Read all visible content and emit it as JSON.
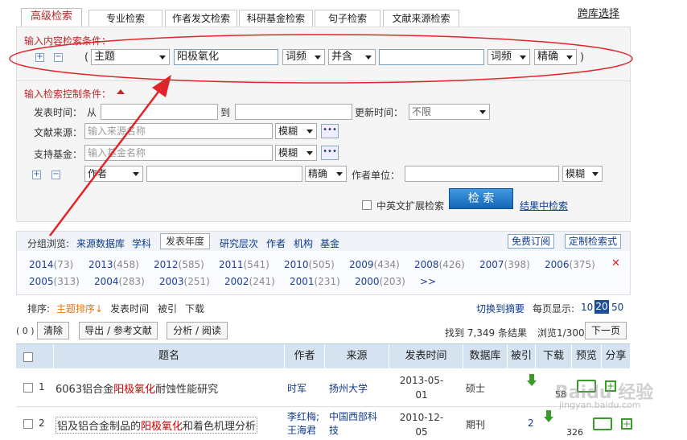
{
  "tabs": [
    "高级检索",
    "专业检索",
    "作者发文检索",
    "科研基金检索",
    "句子检索",
    "文献来源检索"
  ],
  "cross_search": "跨库选择",
  "content_label": "输入内容检索条件：",
  "row1": {
    "open": "(",
    "field": "主题",
    "term": "阳极氧化",
    "freq": "词频",
    "logic": "并含",
    "term2": "",
    "freq2": "词频",
    "match": "精确",
    "close": ")"
  },
  "control_label": "输入检索控制条件：",
  "pub_time": {
    "label": "发表时间：",
    "from": "从",
    "to": "到",
    "update_label": "更新时间：",
    "update_value": "不限"
  },
  "source": {
    "label": "文献来源：",
    "placeholder": "输入来源名称",
    "match": "模糊",
    "more": "•••"
  },
  "fund": {
    "label": "支持基金：",
    "placeholder": "输入基金名称",
    "match": "模糊",
    "more": "•••"
  },
  "author_row": {
    "field": "作者",
    "match": "精确",
    "unit_label": "作者单位：",
    "unit_match": "模糊"
  },
  "ext_search": "中英文扩展检索",
  "search_btn": "检 索",
  "within_results": "结果中检索",
  "group": {
    "label": "分组浏览:",
    "items": [
      "来源数据库",
      "学科",
      "发表年度",
      "研究层次",
      "作者",
      "机构",
      "基金"
    ],
    "free_sub": "免费订阅",
    "custom": "定制检索式"
  },
  "years_row1": [
    {
      "y": "2014",
      "c": "(73)"
    },
    {
      "y": "2013",
      "c": "(458)"
    },
    {
      "y": "2012",
      "c": "(585)"
    },
    {
      "y": "2011",
      "c": "(541)"
    },
    {
      "y": "2010",
      "c": "(505)"
    },
    {
      "y": "2009",
      "c": "(434)"
    },
    {
      "y": "2008",
      "c": "(426)"
    },
    {
      "y": "2007",
      "c": "(398)"
    },
    {
      "y": "2006",
      "c": "(375)"
    }
  ],
  "years_row2": [
    {
      "y": "2005",
      "c": "(313)"
    },
    {
      "y": "2004",
      "c": "(283)"
    },
    {
      "y": "2003",
      "c": "(251)"
    },
    {
      "y": "2002",
      "c": "(241)"
    },
    {
      "y": "2001",
      "c": "(231)"
    },
    {
      "y": "2000",
      "c": "(203)"
    }
  ],
  "more_years": ">>",
  "close_x": "✕",
  "sort": {
    "label": "排序:",
    "topic": "主题排序",
    "pub": "发表时间",
    "cited": "被引",
    "download": "下载"
  },
  "switch_abstract": "切换到摘要",
  "per_page": {
    "label": "每页显示:",
    "opts": [
      "10",
      "20",
      "50"
    ]
  },
  "count_sel": "( 0 )",
  "clear": "清除",
  "export": "导出 / 参考文献",
  "analysis": "分析 / 阅读",
  "result_count": "找到 7,349 条结果",
  "browse": "浏览1/300",
  "next_page": "下一页",
  "columns": [
    "题名",
    "作者",
    "来源",
    "发表时间",
    "数据库",
    "被引",
    "下载",
    "预览",
    "分享"
  ],
  "rows": [
    {
      "num": "1",
      "title_pre": "6063铝合金",
      "title_hl": "阳极氧化",
      "title_post": "耐蚀性能研究",
      "author": "时军",
      "source": "扬州大学",
      "date": "2013-05-01",
      "db": "硕士",
      "cited": "",
      "dl": "58"
    },
    {
      "num": "2",
      "title_pre": "铝及铝合金制品的",
      "title_hl": "阳极氧化",
      "title_post": "和着色机理分析",
      "author": "李红梅;王海君",
      "source": "中国西部科技",
      "date": "2010-12-05",
      "db": "期刊",
      "cited": "2",
      "dl": "326"
    }
  ],
  "watermark": "Baidu 经验",
  "watermark_url": "jingyan.baidu.com"
}
